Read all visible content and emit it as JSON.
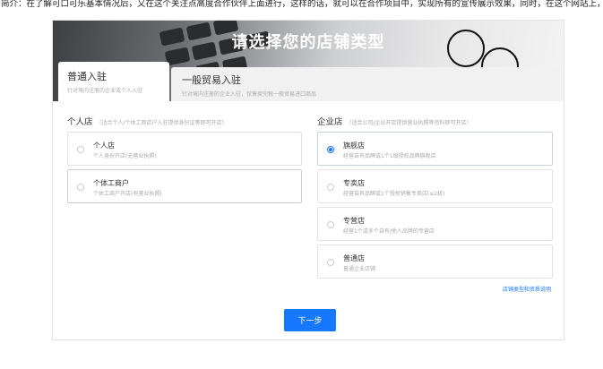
{
  "notice": "简介：在了解可口可乐基本情况后，又在这个关注点高度合作伙伴上面进行，这样的话，就可以在合作项目中，实现所有的宣传展示效果，同时，在这个网站上，进一步地，实现大家所关注的，开展商业活动的各项准备事项",
  "banner": {
    "title": "请选择您的店铺类型"
  },
  "tabs": [
    {
      "title": "普通入驻",
      "subtitle": "针对境内注册的企业或个人入驻"
    },
    {
      "title": "一般贸易入驻",
      "subtitle": "针对境内注册的企业入驻，仅售卖完税一般贸易进口商品"
    }
  ],
  "personal": {
    "heading": "个人店",
    "note": "（适合个人/个体工商店户入驻提供身份证等即可开店）",
    "options": [
      {
        "name": "个人店",
        "desc": "个人身份开店(无营业执照)"
      },
      {
        "name": "个体工商户",
        "desc": "个体工商户开店(有营业执照)"
      }
    ]
  },
  "enterprise": {
    "heading": "企业店",
    "note": "（适合公司/企业开店提供营业执照等资料即可开店）",
    "options": [
      {
        "name": "旗舰店",
        "desc": "经营自有品牌或1个1级授权品牌旗舰店"
      },
      {
        "name": "专卖店",
        "desc": "经营自有品牌或1个授权销售专卖店(≤2级)"
      },
      {
        "name": "专营店",
        "desc": "经营1个或多个自有/他人品牌的专营店"
      },
      {
        "name": "普通店",
        "desc": "普通企业店铺"
      }
    ]
  },
  "info_link": "店铺类型和资质说明",
  "next_label": "下一步"
}
